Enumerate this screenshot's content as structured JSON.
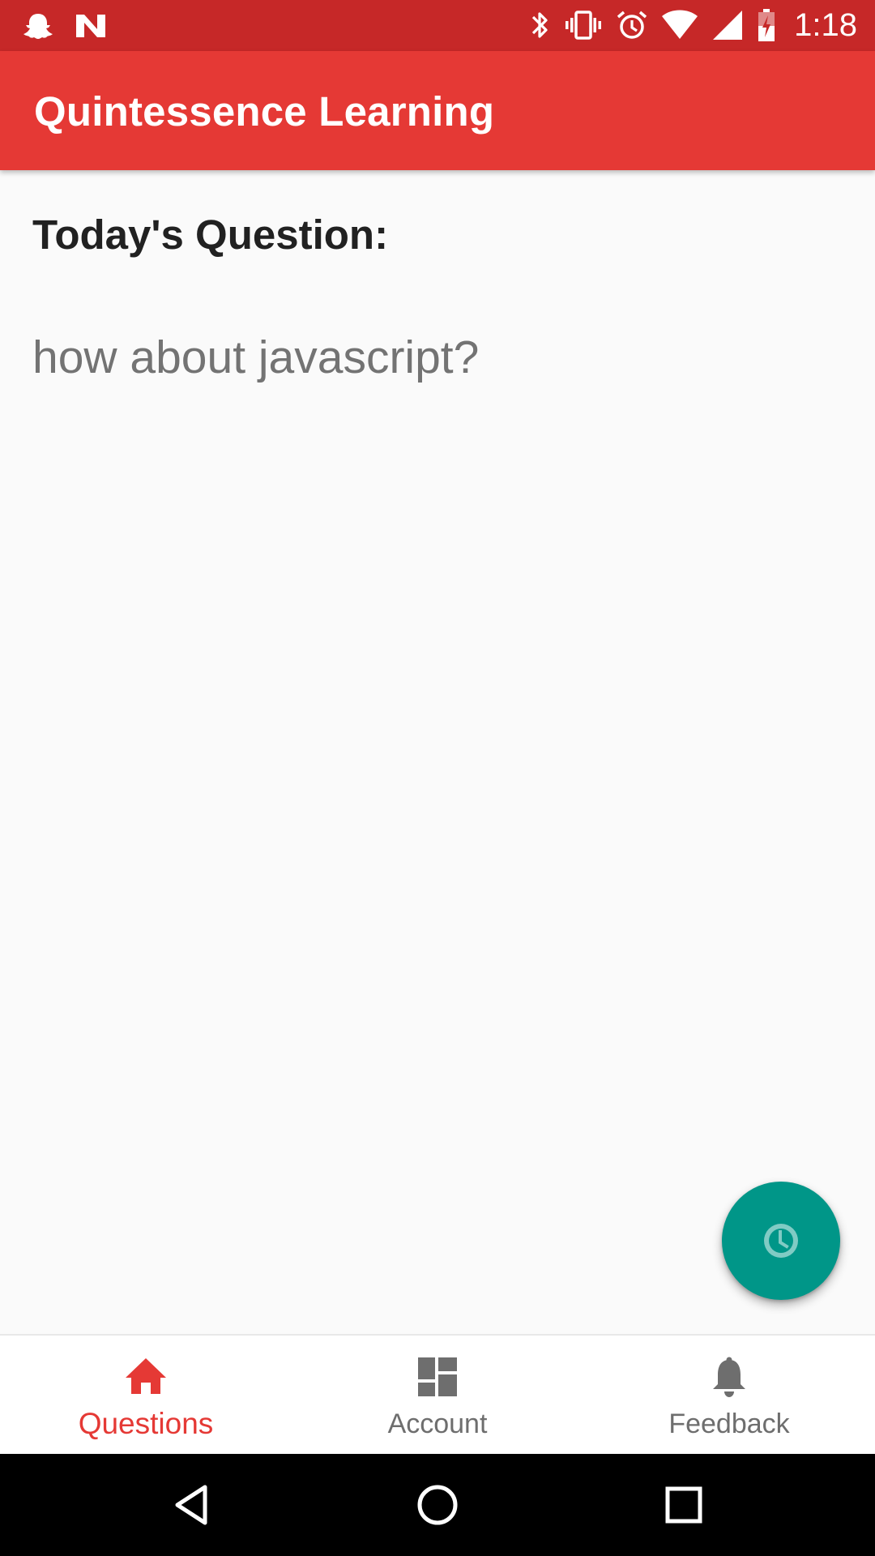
{
  "status_bar": {
    "time": "1:18",
    "left_icons": [
      "snapchat-icon",
      "n-app-icon"
    ],
    "right_icons": [
      "bluetooth-icon",
      "vibrate-icon",
      "alarm-icon",
      "wifi-icon",
      "signal-icon",
      "battery-charging-icon"
    ]
  },
  "app_bar": {
    "title": "Quintessence Learning"
  },
  "content": {
    "heading": "Today's Question:",
    "question": "how about javascript?"
  },
  "fab": {
    "icon": "clock-icon"
  },
  "bottom_nav": {
    "items": [
      {
        "label": "Questions",
        "icon": "home-icon",
        "active": true
      },
      {
        "label": "Account",
        "icon": "dashboard-icon",
        "active": false
      },
      {
        "label": "Feedback",
        "icon": "bell-icon",
        "active": false
      }
    ]
  },
  "system_nav": {
    "buttons": [
      "back-icon",
      "home-circle-icon",
      "recents-icon"
    ]
  },
  "colors": {
    "status_bar": "#c62828",
    "app_bar": "#e53935",
    "accent_fab": "#009688",
    "active_nav": "#e53935",
    "inactive_nav": "#6e6e6e",
    "background": "#fafafa"
  }
}
